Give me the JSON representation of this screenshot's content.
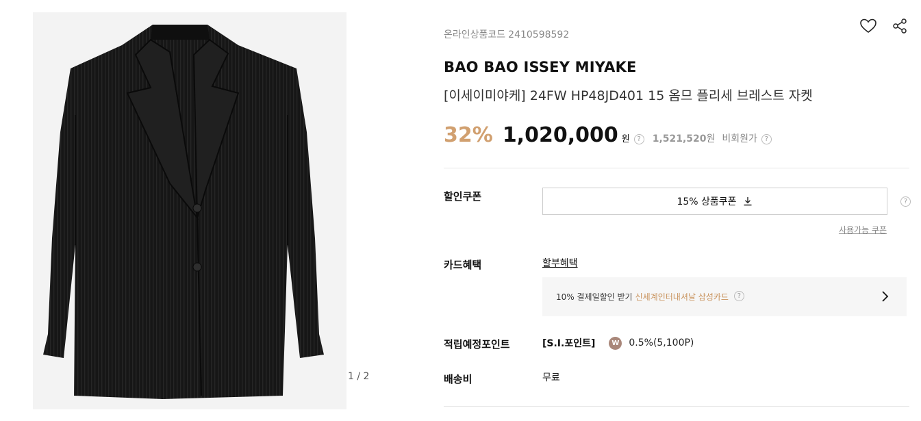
{
  "gallery": {
    "counter": "1 / 2"
  },
  "product": {
    "code_label": "온라인상품코드",
    "code_value": "2410598592",
    "brand": "BAO BAO ISSEY MIYAKE",
    "name": "[이세이미야케] 24FW HP48JD401 15 옴므 플리세 브레스트 자켓"
  },
  "price": {
    "discount_rate": "32%",
    "sale_price": "1,020,000",
    "won": "원",
    "help": "?",
    "original_price": "1,521,520",
    "original_won": "원",
    "nonmember": "비회원가"
  },
  "coupon": {
    "label": "할인쿠폰",
    "button_label": "15% 상품쿠폰",
    "available_link": "사용가능 쿠폰"
  },
  "card": {
    "label": "카드혜택",
    "link": "할부혜택",
    "benefit_text": "10% 결제일할인 받기",
    "benefit_highlight": "신세계인터내셔날 삼성카드"
  },
  "points": {
    "label": "적립예정포인트",
    "program": "[S.I.포인트]",
    "badge": "W",
    "value": "0.5%(5,100P)"
  },
  "shipping": {
    "label": "배송비",
    "value": "무료"
  },
  "colors": {
    "accent": "#d1a070",
    "highlight": "#c8915a",
    "badge": "#a9877a"
  }
}
